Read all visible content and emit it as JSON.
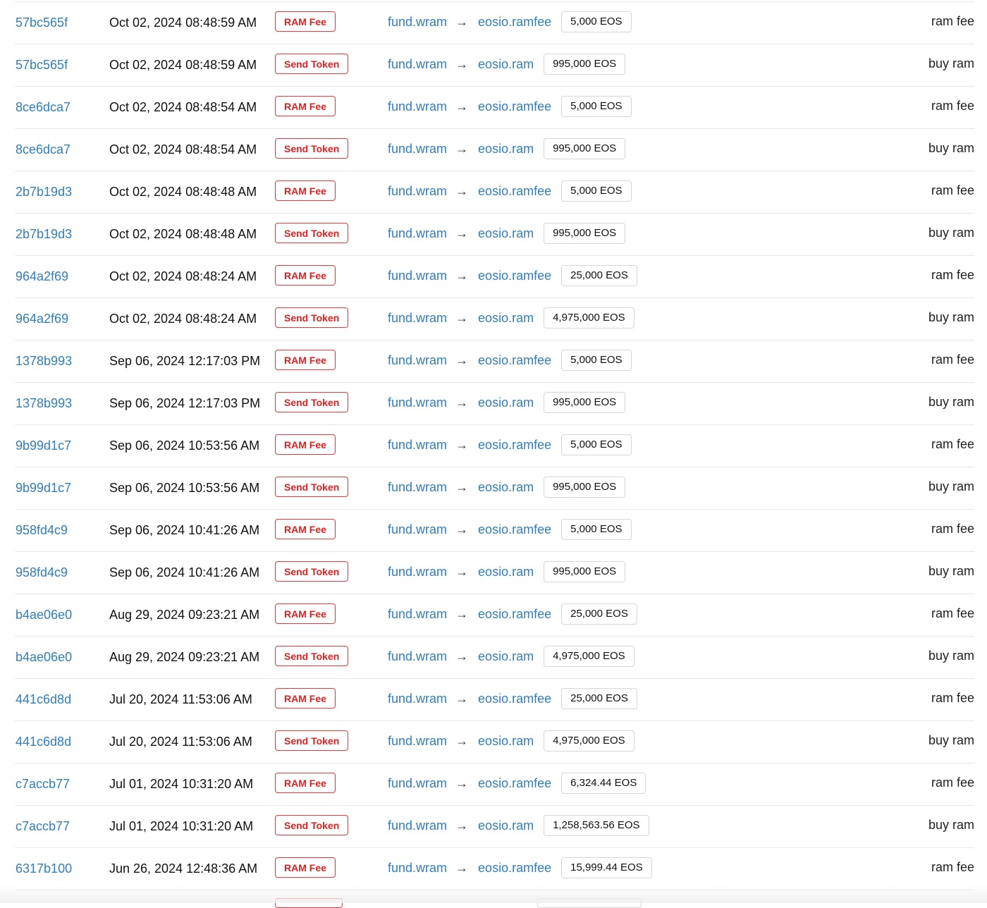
{
  "arrow": "→",
  "transactions": [
    {
      "hash": "57bc565f",
      "date": "Oct 02, 2024 08:48:59 AM",
      "action": "RAM Fee",
      "from": "fund.wram",
      "to": "eosio.ramfee",
      "amount": "5,000 EOS",
      "memo": "ram fee"
    },
    {
      "hash": "57bc565f",
      "date": "Oct 02, 2024 08:48:59 AM",
      "action": "Send Token",
      "from": "fund.wram",
      "to": "eosio.ram",
      "amount": "995,000 EOS",
      "memo": "buy ram"
    },
    {
      "hash": "8ce6dca7",
      "date": "Oct 02, 2024 08:48:54 AM",
      "action": "RAM Fee",
      "from": "fund.wram",
      "to": "eosio.ramfee",
      "amount": "5,000 EOS",
      "memo": "ram fee"
    },
    {
      "hash": "8ce6dca7",
      "date": "Oct 02, 2024 08:48:54 AM",
      "action": "Send Token",
      "from": "fund.wram",
      "to": "eosio.ram",
      "amount": "995,000 EOS",
      "memo": "buy ram"
    },
    {
      "hash": "2b7b19d3",
      "date": "Oct 02, 2024 08:48:48 AM",
      "action": "RAM Fee",
      "from": "fund.wram",
      "to": "eosio.ramfee",
      "amount": "5,000 EOS",
      "memo": "ram fee"
    },
    {
      "hash": "2b7b19d3",
      "date": "Oct 02, 2024 08:48:48 AM",
      "action": "Send Token",
      "from": "fund.wram",
      "to": "eosio.ram",
      "amount": "995,000 EOS",
      "memo": "buy ram"
    },
    {
      "hash": "964a2f69",
      "date": "Oct 02, 2024 08:48:24 AM",
      "action": "RAM Fee",
      "from": "fund.wram",
      "to": "eosio.ramfee",
      "amount": "25,000 EOS",
      "memo": "ram fee"
    },
    {
      "hash": "964a2f69",
      "date": "Oct 02, 2024 08:48:24 AM",
      "action": "Send Token",
      "from": "fund.wram",
      "to": "eosio.ram",
      "amount": "4,975,000 EOS",
      "memo": "buy ram"
    },
    {
      "hash": "1378b993",
      "date": "Sep 06, 2024 12:17:03 PM",
      "action": "RAM Fee",
      "from": "fund.wram",
      "to": "eosio.ramfee",
      "amount": "5,000 EOS",
      "memo": "ram fee"
    },
    {
      "hash": "1378b993",
      "date": "Sep 06, 2024 12:17:03 PM",
      "action": "Send Token",
      "from": "fund.wram",
      "to": "eosio.ram",
      "amount": "995,000 EOS",
      "memo": "buy ram"
    },
    {
      "hash": "9b99d1c7",
      "date": "Sep 06, 2024 10:53:56 AM",
      "action": "RAM Fee",
      "from": "fund.wram",
      "to": "eosio.ramfee",
      "amount": "5,000 EOS",
      "memo": "ram fee"
    },
    {
      "hash": "9b99d1c7",
      "date": "Sep 06, 2024 10:53:56 AM",
      "action": "Send Token",
      "from": "fund.wram",
      "to": "eosio.ram",
      "amount": "995,000 EOS",
      "memo": "buy ram"
    },
    {
      "hash": "958fd4c9",
      "date": "Sep 06, 2024 10:41:26 AM",
      "action": "RAM Fee",
      "from": "fund.wram",
      "to": "eosio.ramfee",
      "amount": "5,000 EOS",
      "memo": "ram fee"
    },
    {
      "hash": "958fd4c9",
      "date": "Sep 06, 2024 10:41:26 AM",
      "action": "Send Token",
      "from": "fund.wram",
      "to": "eosio.ram",
      "amount": "995,000 EOS",
      "memo": "buy ram"
    },
    {
      "hash": "b4ae06e0",
      "date": "Aug 29, 2024 09:23:21 AM",
      "action": "RAM Fee",
      "from": "fund.wram",
      "to": "eosio.ramfee",
      "amount": "25,000 EOS",
      "memo": "ram fee"
    },
    {
      "hash": "b4ae06e0",
      "date": "Aug 29, 2024 09:23:21 AM",
      "action": "Send Token",
      "from": "fund.wram",
      "to": "eosio.ram",
      "amount": "4,975,000 EOS",
      "memo": "buy ram"
    },
    {
      "hash": "441c6d8d",
      "date": "Jul 20, 2024 11:53:06 AM",
      "action": "RAM Fee",
      "from": "fund.wram",
      "to": "eosio.ramfee",
      "amount": "25,000 EOS",
      "memo": "ram fee"
    },
    {
      "hash": "441c6d8d",
      "date": "Jul 20, 2024 11:53:06 AM",
      "action": "Send Token",
      "from": "fund.wram",
      "to": "eosio.ram",
      "amount": "4,975,000 EOS",
      "memo": "buy ram"
    },
    {
      "hash": "c7accb77",
      "date": "Jul 01, 2024 10:31:20 AM",
      "action": "RAM Fee",
      "from": "fund.wram",
      "to": "eosio.ramfee",
      "amount": "6,324.44 EOS",
      "memo": "ram fee"
    },
    {
      "hash": "c7accb77",
      "date": "Jul 01, 2024 10:31:20 AM",
      "action": "Send Token",
      "from": "fund.wram",
      "to": "eosio.ram",
      "amount": "1,258,563.56 EOS",
      "memo": "buy ram"
    },
    {
      "hash": "6317b100",
      "date": "Jun 26, 2024 12:48:36 AM",
      "action": "RAM Fee",
      "from": "fund.wram",
      "to": "eosio.ramfee",
      "amount": "15,999.44 EOS",
      "memo": "ram fee"
    }
  ]
}
